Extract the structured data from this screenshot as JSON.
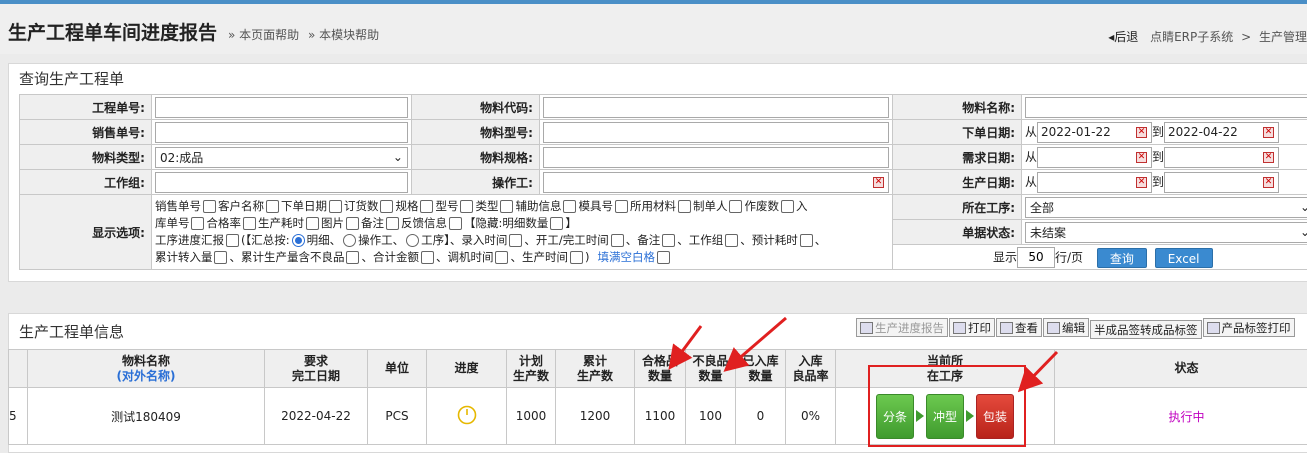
{
  "header": {
    "title": "生产工程单车间进度报告",
    "help_page": "» 本页面帮助",
    "help_module": "» 本模块帮助",
    "back": "后退",
    "crumb1": "点睛ERP子系统",
    "crumb_sep": ">",
    "crumb2": "生产管理"
  },
  "query": {
    "title": "查询生产工程单",
    "labels": {
      "order_no": "工程单号:",
      "sales_no": "销售单号:",
      "material_type": "物料类型:",
      "work_group": "工作组:",
      "display_opts": "显示选项:",
      "material_code": "物料代码:",
      "material_model": "物料型号:",
      "material_spec": "物料规格:",
      "operator": "操作工:",
      "material_name": "物料名称:",
      "order_date": "下单日期:",
      "demand_date": "需求日期:",
      "prod_date": "生产日期:",
      "process": "所在工序:",
      "doc_status": "单据状态:"
    },
    "from": "从",
    "to": "到",
    "material_type_value": "02:成品",
    "order_date_from": "2022-01-22",
    "order_date_to": "2022-04-22",
    "process_value": "全部",
    "doc_status_value": "未结案",
    "show_prefix": "显示",
    "per_page": "50",
    "per_page_suffix": "行/页",
    "search_btn": "查询",
    "excel_btn": "Excel",
    "opts": {
      "line1": [
        "销售单号",
        "客户名称",
        "下单日期",
        "订货数",
        "规格",
        "型号",
        "类型",
        "辅助信息",
        "模具号",
        "所用材料",
        "制单人",
        "作废数",
        "入"
      ],
      "line2a": "库单号",
      "line2": [
        "合格率",
        "生产耗时",
        "图片",
        "备注",
        "反馈信息"
      ],
      "line2_tail": "【隐藏:明细数量",
      "line2_end": "】",
      "line3_head": "工序进度汇报",
      "line3_sum": "(【汇总按:",
      "radio1": "明细、",
      "radio2": "操作工、",
      "radio3": "工序】、录入时间",
      "line3_rest": [
        "、开工/完工时间",
        "、备注",
        "、工作组",
        "、预计耗时"
      ],
      "line3_end": "、",
      "line4": [
        "累计转入量",
        "、累计生产量含不良品",
        "、合计金额",
        "、调机时间",
        "、生产时间"
      ],
      "line4_end": ")",
      "fill_blank": "填满空白格"
    }
  },
  "info": {
    "title": "生产工程单信息",
    "toolbar": [
      "生产进度报告",
      "打印",
      "查看",
      "编辑",
      "半成品签转成品标签",
      "产品标签打印"
    ],
    "columns": [
      "物料名称",
      "要求\n完工日期",
      "单位",
      "进度",
      "计划\n生产数",
      "累计\n生产数",
      "合格品\n数量",
      "不良品\n数量",
      "已入库\n数量",
      "入库\n良品率",
      "当前所\n在工序",
      "状态"
    ],
    "external_name": "(对外名称)",
    "row": {
      "idx": "5",
      "name": "测试180409",
      "due": "2022-04-22",
      "unit": "PCS",
      "plan": "1000",
      "produced": "1200",
      "good": "1100",
      "bad": "100",
      "stocked": "0",
      "rate": "0%",
      "stages": [
        "分条",
        "冲型",
        "包装"
      ],
      "status": "执行中"
    }
  },
  "colors": {
    "accent": "#3a8ad0",
    "stage_done": "#4caf3a",
    "stage_current": "#d9342a",
    "status": "#c000c0",
    "annotation": "#e02020"
  }
}
